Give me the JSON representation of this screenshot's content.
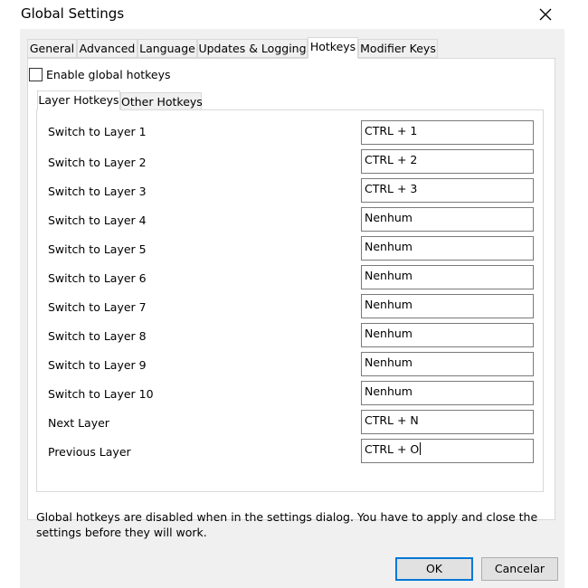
{
  "window": {
    "title": "Global Settings",
    "close_icon": "close-icon"
  },
  "main_tabs": [
    {
      "label": "General"
    },
    {
      "label": "Advanced"
    },
    {
      "label": "Language"
    },
    {
      "label": "Updates & Logging"
    },
    {
      "label": "Hotkeys",
      "active": true
    },
    {
      "label": "Modifier Keys"
    }
  ],
  "enable_checkbox": {
    "label": "Enable global hotkeys",
    "checked": false
  },
  "sub_tabs": [
    {
      "label": "Layer Hotkeys",
      "active": true
    },
    {
      "label": "Other Hotkeys"
    }
  ],
  "hotkeys": [
    {
      "label": "Switch to Layer 1",
      "value": "CTRL + 1"
    },
    {
      "label": "Switch to Layer 2",
      "value": "CTRL + 2"
    },
    {
      "label": "Switch to Layer 3",
      "value": "CTRL + 3"
    },
    {
      "label": "Switch to Layer 4",
      "value": "Nenhum"
    },
    {
      "label": "Switch to Layer 5",
      "value": "Nenhum"
    },
    {
      "label": "Switch to Layer 6",
      "value": "Nenhum"
    },
    {
      "label": "Switch to Layer 7",
      "value": "Nenhum"
    },
    {
      "label": "Switch to Layer 8",
      "value": "Nenhum"
    },
    {
      "label": "Switch to Layer 9",
      "value": "Nenhum"
    },
    {
      "label": "Switch to Layer 10",
      "value": "Nenhum"
    },
    {
      "label": "Next Layer",
      "value": "CTRL + N"
    },
    {
      "label": "Previous Layer",
      "value": "CTRL + O"
    }
  ],
  "footer_note": "Global hotkeys are disabled when in the settings dialog. You have to apply and close the settings before they will work.",
  "buttons": {
    "ok": "OK",
    "cancel": "Cancelar"
  },
  "colors": {
    "accent": "#0078d7",
    "dialog_bg": "#f0f0f0",
    "panel_bg": "#ffffff"
  }
}
